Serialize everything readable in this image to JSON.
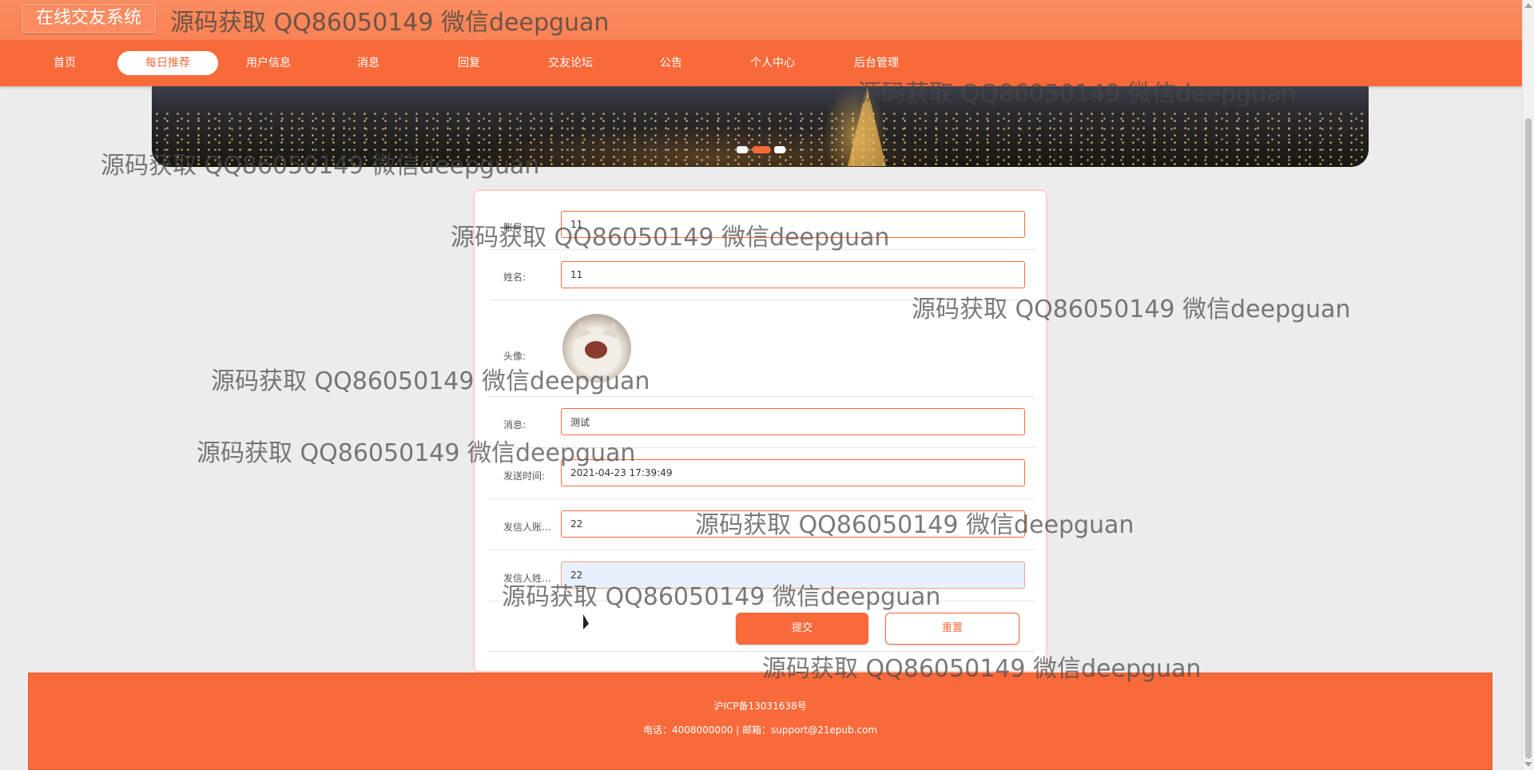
{
  "header": {
    "system_title": "在线交友系统",
    "watermark": "源码获取 QQ86050149 微信deepguan"
  },
  "nav": {
    "items": [
      {
        "label": "首页"
      },
      {
        "label": "每日推荐",
        "active": true
      },
      {
        "label": "用户信息"
      },
      {
        "label": "消息"
      },
      {
        "label": "回复"
      },
      {
        "label": "交友论坛"
      },
      {
        "label": "公告"
      },
      {
        "label": "个人中心"
      },
      {
        "label": "后台管理"
      }
    ]
  },
  "banner": {
    "active_slide": 2,
    "slide_count": 3
  },
  "form": {
    "account": {
      "label": "账号:",
      "value": "11"
    },
    "name": {
      "label": "姓名:",
      "value": "11"
    },
    "avatar": {
      "label": "头像:"
    },
    "message": {
      "label": "消息:",
      "value": "测试"
    },
    "send_time": {
      "label": "发送时间:",
      "value": "2021-04-23 17:39:49"
    },
    "sender_account": {
      "label": "发信人账...",
      "value": "22"
    },
    "sender_name": {
      "label": "发信人姓...",
      "value": "22"
    },
    "submit_label": "提交",
    "reset_label": "重置"
  },
  "footer": {
    "icp": "沪ICP备13031638号",
    "contact": "电话：4008000000 | 邮箱：support@21epub.com"
  },
  "watermarks": [
    "源码获取 QQ86050149 微信deepguan",
    "源码获取 QQ86050149 微信deepguan",
    "源码获取 QQ86050149 微信deepguan",
    "源码获取 QQ86050149 微信deepguan",
    "源码获取 QQ86050149 微信deepguan",
    "源码获取 QQ86050149 微信deepguan",
    "源码获取 QQ86050149 微信deepguan",
    "源码获取 QQ86050149 微信deepguan",
    "源码获取 QQ86050149 微信deepguan"
  ],
  "colors": {
    "accent": "#f96a3b",
    "topbar": "#fb8a5e",
    "background": "#ececec"
  }
}
